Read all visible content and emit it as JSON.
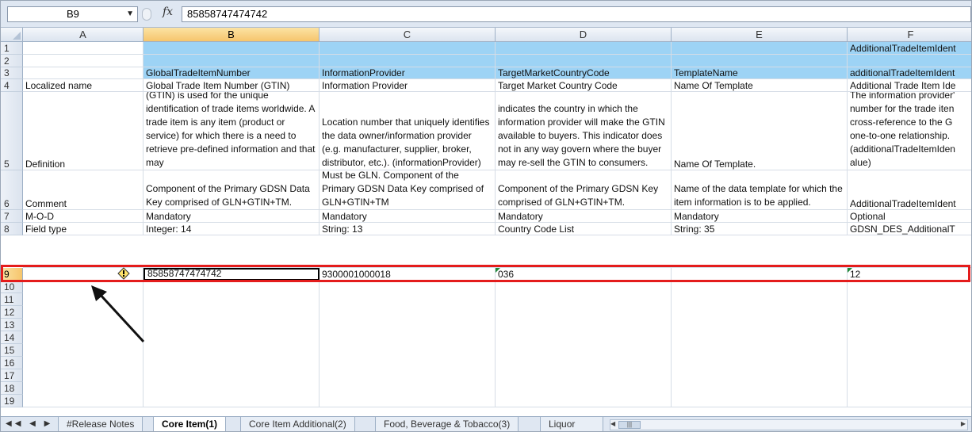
{
  "formula_bar": {
    "name_box": "B9",
    "fx": "fx",
    "formula": "85858747474742"
  },
  "columns": [
    "A",
    "B",
    "C",
    "D",
    "E",
    "F"
  ],
  "row_numbers": [
    "1",
    "2",
    "3",
    "4",
    "5",
    "6",
    "7",
    "8",
    "9",
    "10",
    "11",
    "12",
    "13",
    "14",
    "15",
    "16",
    "17",
    "18",
    "19"
  ],
  "rows": {
    "r1": {
      "F": "AdditionalTradeItemIdent"
    },
    "r3": {
      "B": "GlobalTradeItemNumber",
      "C": "InformationProvider",
      "D": "TargetMarketCountryCode",
      "E": "TemplateName",
      "F": "additionalTradeItemIdent"
    },
    "r4": {
      "A": "Localized name",
      "B": "Global Trade Item Number (GTIN)",
      "C": "Information Provider",
      "D": "Target Market Country Code",
      "E": "Name Of Template",
      "F": "Additional Trade Item Ide"
    },
    "r5": {
      "A": "Definition",
      "B": "(GTIN) is used for the unique identification of trade items worldwide. A trade item is any item (product or service) for which there is a need to retrieve pre-defined information and that may",
      "C": "Location number that uniquely identifies the data owner/information provider (e.g. manufacturer, supplier, broker, distributor, etc.). (informationProvider)",
      "D": "indicates the country in which the information provider will make the GTIN available to buyers. This indicator does not in any way govern where the buyer may re-sell the GTIN to consumers.",
      "E": "Name Of Template.",
      "F": "The information provider' number for the trade iten cross-reference to the G one-to-one relationship. (additionalTradeItemIden alue)"
    },
    "r6": {
      "A": "Comment",
      "B": "Component of the Primary GDSN Data Key comprised of GLN+GTIN+TM.",
      "C": "Must be GLN. Component of the Primary GDSN Data Key comprised of GLN+GTIN+TM",
      "D": "Component of the Primary GDSN Key comprised of GLN+GTIN+TM.",
      "E": "Name of the data template for which the item information is to be applied.",
      "F": "AdditionalTradeItemIdent"
    },
    "r7": {
      "A": "M-O-D",
      "B": "Mandatory",
      "C": "Mandatory",
      "D": "Mandatory",
      "E": "Mandatory",
      "F": "Optional"
    },
    "r8": {
      "A": "Field type",
      "B": "Integer: 14",
      "C": "String: 13",
      "D": "Country Code List",
      "E": "String: 35",
      "F": "GDSN_DES_AdditionalT"
    },
    "r9": {
      "A": "",
      "B": "85858747474742",
      "C": "9300001000018",
      "D": "036",
      "E": "",
      "F": "12"
    }
  },
  "sheet_tabs": [
    "#Release Notes",
    "Core Item(1)",
    "Core Item Additional(2)",
    "Food, Beverage & Tobacco(3)",
    "Liquor"
  ],
  "active_tab": "Core Item(1)",
  "colors": {
    "header_fill": "#9dd3f5",
    "highlight": "#e41c1c",
    "active_header": "#f6c56c"
  }
}
